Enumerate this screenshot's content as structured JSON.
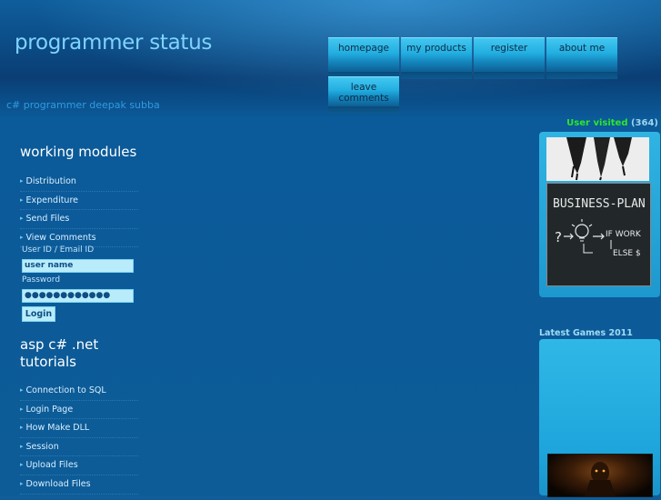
{
  "header": {
    "site_title": "programmer status",
    "tagline": "c# programmer deepak subba"
  },
  "nav": {
    "items": [
      {
        "label": "homepage"
      },
      {
        "label": "my products"
      },
      {
        "label": "register"
      },
      {
        "label": "about me"
      },
      {
        "label": "leave comments"
      }
    ]
  },
  "visitors": {
    "label": "User visited",
    "count": "(364)"
  },
  "modules": {
    "heading": "working modules",
    "items": [
      {
        "label": "Distribution"
      },
      {
        "label": "Expenditure"
      },
      {
        "label": "Send Files"
      },
      {
        "label": "View Comments"
      }
    ]
  },
  "login_form": {
    "user_label": "User ID / Email ID",
    "user_value": "user name",
    "password_label": "Password",
    "password_value": "●●●●●●●●●●●●",
    "login_label": "Login"
  },
  "tutorials": {
    "heading_line1": "asp c# .net",
    "heading_line2": "tutorials",
    "items": [
      {
        "label": "Connection to SQL"
      },
      {
        "label": "Login Page"
      },
      {
        "label": "How Make DLL"
      },
      {
        "label": "Session"
      },
      {
        "label": "Upload Files"
      },
      {
        "label": "Download Files"
      }
    ]
  },
  "sidebar": {
    "games_label": "Latest Games 2011",
    "business_plan_text": "BUSINESS-PLAN",
    "board_if": "IF WORK",
    "board_else": "ELSE $"
  },
  "colors": {
    "title": "#7fd3ff",
    "tagline": "#2f9be0",
    "visited_label": "#2ee52a",
    "nav_button": "#22aee0",
    "input_bg": "#b9ecfb"
  }
}
